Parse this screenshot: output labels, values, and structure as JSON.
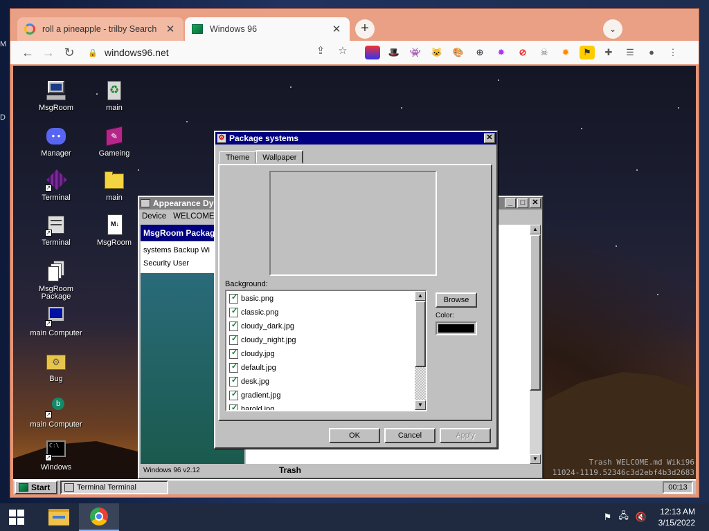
{
  "browser": {
    "tabs": [
      {
        "title": "roll a pineapple - trilby Search",
        "icon": "google-icon",
        "active": false
      },
      {
        "title": "Windows 96",
        "icon": "windows96-icon",
        "active": true
      }
    ],
    "new_tab_label": "+",
    "url": "windows96.net"
  },
  "win96": {
    "desktop_icons": [
      {
        "label": "MsgRoom",
        "icon": "computer-icon"
      },
      {
        "label": "main",
        "icon": "recycle-bin-icon"
      },
      {
        "label": "Manager",
        "icon": "discord-icon"
      },
      {
        "label": "Gameing",
        "icon": "book-icon"
      },
      {
        "label": "Terminal",
        "icon": "cube-icon"
      },
      {
        "label": "main",
        "icon": "folder-icon"
      },
      {
        "label": "Terminal",
        "icon": "printer-icon"
      },
      {
        "label": "MsgRoom",
        "icon": "markdown-file-icon"
      },
      {
        "label": "MsgRoom Package",
        "icon": "stack-icon"
      },
      {
        "label": "main Computer",
        "icon": "monitor-icon"
      },
      {
        "label": "Bug",
        "icon": "bug-folder-icon"
      },
      {
        "label": "main Computer",
        "icon": "bing-icon"
      },
      {
        "label": "Windows",
        "icon": "terminal-icon"
      }
    ],
    "appearance_window": {
      "title": "Appearance Dy",
      "menu": [
        "Device",
        "WELCOME.m"
      ],
      "panel_title": "MsgRoom Packag",
      "panel_items": [
        "systems Backup Wi",
        "Security User"
      ],
      "trash_label": "Trash",
      "status": "Windows 96 v2.12"
    },
    "package_window": {
      "title": "Package systems",
      "tabs": [
        "Theme",
        "Wallpaper"
      ],
      "active_tab": "Wallpaper",
      "background_label": "Background:",
      "files": [
        "basic.png",
        "classic.png",
        "cloudy_dark.jpg",
        "cloudy_night.jpg",
        "cloudy.jpg",
        "default.jpg",
        "desk.jpg",
        "gradient.jpg",
        "harold.jpg"
      ],
      "browse_label": "Browse",
      "color_label": "Color:",
      "color_value": "#000000",
      "ok_label": "OK",
      "cancel_label": "Cancel",
      "apply_label": "Apply"
    },
    "taskbar": {
      "start_label": "Start",
      "task_label": "Terminal Terminal",
      "clock": "00:13"
    },
    "wiki_lines": [
      "Trash WELCOME.md Wiki96",
      "11024-1119.52346c3d2ebf4b3d2683"
    ]
  },
  "host_taskbar": {
    "time": "12:13 AM",
    "date": "3/15/2022"
  }
}
